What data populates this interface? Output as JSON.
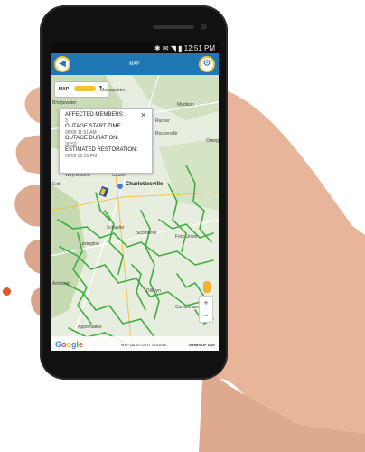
{
  "status_bar": {
    "time": "12:51 PM"
  },
  "app_bar": {
    "title": "MAP"
  },
  "map_layer": {
    "label": "MAP"
  },
  "popup": {
    "affected_members_label": "AFFECTED MEMBERS:",
    "affected_members_value": "3",
    "outage_start_label": "OUTAGE START TIME:",
    "outage_start_value": "06/09 11:51 AM",
    "outage_duration_label": "OUTAGE DURATION:",
    "outage_duration_value": "00:59",
    "estimated_restoration_label": "ESTIMATED RESTORATION:",
    "estimated_restoration_value": "06/09 02:55 PM"
  },
  "places": {
    "massanutten": "Massanutten",
    "bridgewater": "Bridgewater",
    "madison": "Madison",
    "rucker": "Rucker",
    "rockerville": "Rockerville",
    "orange": "Orang",
    "waynesboro": "Waynesboro",
    "crozet": "Crozet",
    "charlottesville": "Charlottesville",
    "exit": "Exit",
    "lexington": "Lexington",
    "schuyler": "Schuyler",
    "scottsville": "Scottsville",
    "fork_union": "Fork Union",
    "amherst": "Amherst",
    "dillwyn": "Dillwyn",
    "cumberland": "Cumberland",
    "appomattox": "Appomattox"
  },
  "attribution": {
    "google": "Google",
    "map_data": "MAP DATA ©2017 GOOGLE",
    "terms": "TERMS OF USE"
  },
  "zoom": {
    "in": "+",
    "out": "−"
  },
  "colors": {
    "app_bar": "#1f78b4",
    "lines": "#3fae3f",
    "accent": "#e0572a",
    "button_ring": "#f2c230"
  },
  "icons": {
    "back": "back-arrow-icon",
    "settings": "gear-icon",
    "pegman": "pegman-icon",
    "outage": "outage-marker-icon"
  }
}
